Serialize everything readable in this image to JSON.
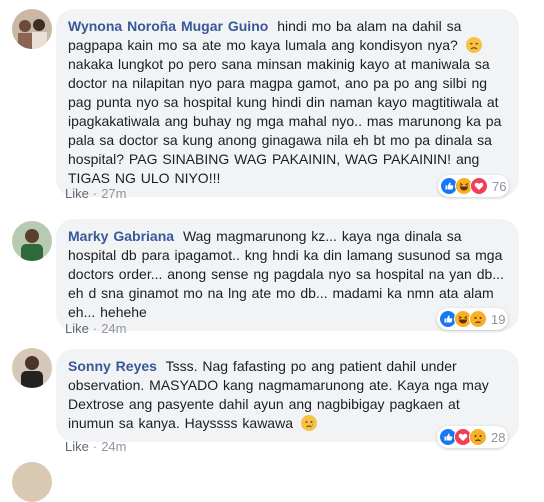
{
  "comments": [
    {
      "author": "Wynona Noroña Mugar Guino",
      "text": "hindi mo ba alam na dahil sa pagpapa kain mo sa ate mo kaya lumala ang kondisyon nya?",
      "text2": "nakaka lungkot po pero sana minsan makinig kayo at maniwala sa doctor na nilapitan nyo para magpa gamot, ano pa po ang silbi ng pag punta nyo sa hospital kung hindi din naman kayo magtitiwala at ipagkakatiwala ang buhay ng mga mahal nyo.. mas marunong ka pa pala sa doctor sa kung anong ginagawa nila eh bt mo pa dinala sa hospital? PAG SINABING WAG PAKAININ, WAG PAKAININ! ang TIGAS NG ULO NIYO!!!",
      "like_label": "Like",
      "time": "27m",
      "reaction_count": "76",
      "reactions": [
        "like-icon",
        "haha-icon",
        "love-icon"
      ]
    },
    {
      "author": "Marky Gabriana",
      "text": "Wag magmarunong kz... kaya nga dinala sa hospital db para ipagamot.. kng hndi ka din lamang susunod sa mga doctors order... anong sense ng pagdala nyo sa hospital na yan db... eh d sna ginamot mo na lng ate mo db... madami ka nmn ata alam eh... hehehe",
      "like_label": "Like",
      "time": "24m",
      "reaction_count": "19",
      "reactions": [
        "like-icon",
        "haha-icon",
        "sad-icon"
      ]
    },
    {
      "author": "Sonny Reyes",
      "text": "Tsss. Nag fafasting po ang patient dahil under observation. MASYADO kang nagmamarunong ate. Kaya nga may Dextrose ang pasyente dahil ayun ang nagbibigay pagkaen at inumun sa kanya. Hayssss kawawa",
      "like_label": "Like",
      "time": "24m",
      "reaction_count": "28",
      "reactions": [
        "like-icon",
        "love-icon",
        "sad-icon"
      ]
    }
  ],
  "separator": "·",
  "colors": {
    "author": "#385898",
    "bubble": "#f2f3f5",
    "like_blue": "#1877f2",
    "love_red": "#f33e58",
    "emoji_yellow": "#f7b125"
  }
}
